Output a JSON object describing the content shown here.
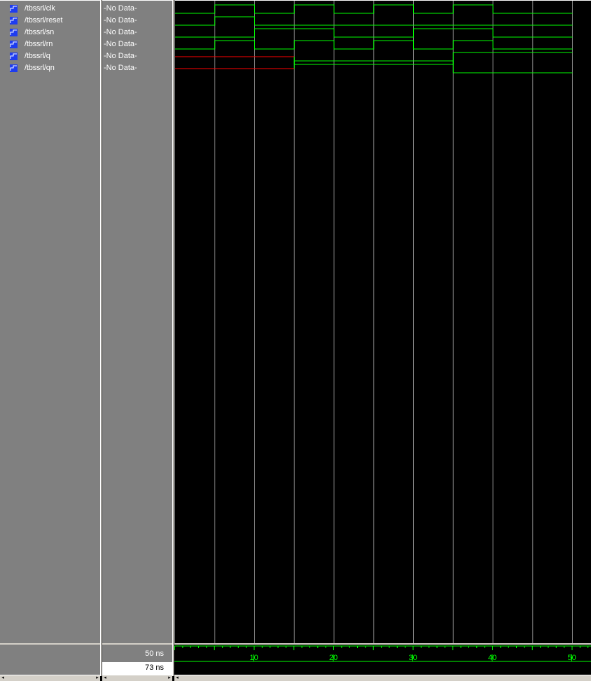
{
  "signals": [
    {
      "name": "/tbssrl/clk",
      "value": "-No Data-"
    },
    {
      "name": "/tbssrl/reset",
      "value": "-No Data-"
    },
    {
      "name": "/tbssrl/sn",
      "value": "-No Data-"
    },
    {
      "name": "/tbssrl/rn",
      "value": "-No Data-"
    },
    {
      "name": "/tbssrl/q",
      "value": "-No Data-"
    },
    {
      "name": "/tbssrl/qn",
      "value": "-No Data-"
    }
  ],
  "status": {
    "grid_time": "50 ns",
    "cursor_time": "73 ns"
  },
  "timeline": {
    "ticks": [
      "10",
      "20",
      "30",
      "40",
      "50"
    ]
  },
  "colors": {
    "waveform": "#00ff00",
    "unknown": "#ff0000",
    "grid": "#808080",
    "background": "#000000"
  },
  "icon": "signal-icon"
}
